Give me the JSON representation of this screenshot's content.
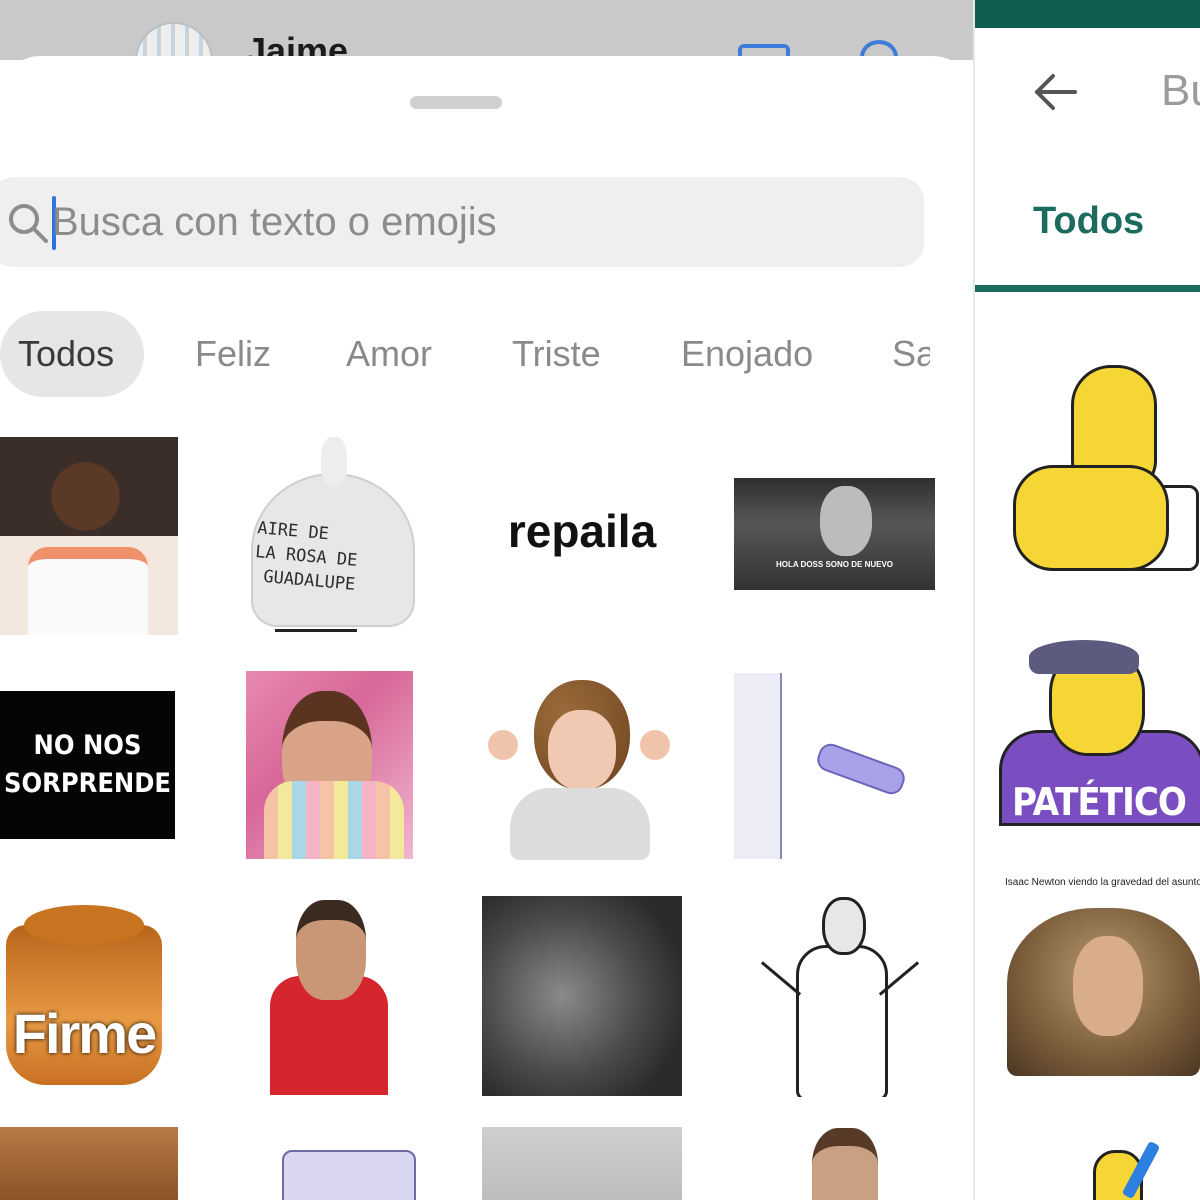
{
  "chat": {
    "contact_name": "Jaime"
  },
  "sheet": {
    "search": {
      "placeholder": "Busca con texto o emojis"
    },
    "categories": [
      {
        "label": "Todos",
        "active": true
      },
      {
        "label": "Feliz",
        "active": false
      },
      {
        "label": "Amor",
        "active": false
      },
      {
        "label": "Triste",
        "active": false
      },
      {
        "label": "Enojado",
        "active": false
      },
      {
        "label": "Sa",
        "active": false
      }
    ],
    "sticker_texts": {
      "bag": "AIRE DE\nLA ROSA DE\n GUADALUPE",
      "repaila": "repaila",
      "hola": "HOLA DOSS SONO DE NUEVO",
      "no_nos": "NO NOS\nSORPRENDE",
      "firme": "Firme"
    }
  },
  "right_panel": {
    "search_title": "Bu",
    "tab_label": "Todos",
    "sticker_texts": {
      "patetico": "PATÉTICO",
      "newton_caption": "Isaac Newton viendo la gravedad del asunto."
    }
  },
  "colors": {
    "whatsapp_green": "#1b6b5f",
    "status_bar": "#0f5e52",
    "caret": "#2f73e0",
    "chip_bg": "#e6e6e6"
  }
}
